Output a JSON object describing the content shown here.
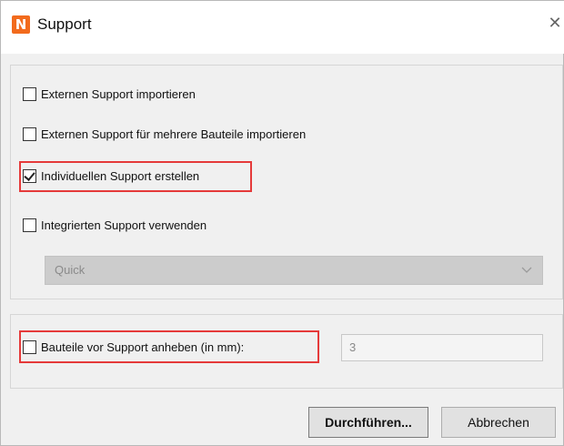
{
  "window": {
    "title": "Support",
    "icon_letter": "N",
    "close_glyph": "✕"
  },
  "options": [
    {
      "label": "Externen Support importieren",
      "checked": false
    },
    {
      "label": "Externen Support für mehrere Bauteile importieren",
      "checked": false
    },
    {
      "label": "Individuellen Support erstellen",
      "checked": true
    },
    {
      "label": "Integrierten Support verwenden",
      "checked": false
    }
  ],
  "support_type_select": {
    "selected": "Quick",
    "enabled": false
  },
  "lift": {
    "label": "Bauteile vor Support anheben (in mm):",
    "checked": false,
    "value": "3"
  },
  "buttons": {
    "execute": "Durchführen...",
    "cancel": "Abbrechen"
  },
  "colors": {
    "accent_icon": "#f26b1d",
    "highlight": "#e53a3a"
  }
}
